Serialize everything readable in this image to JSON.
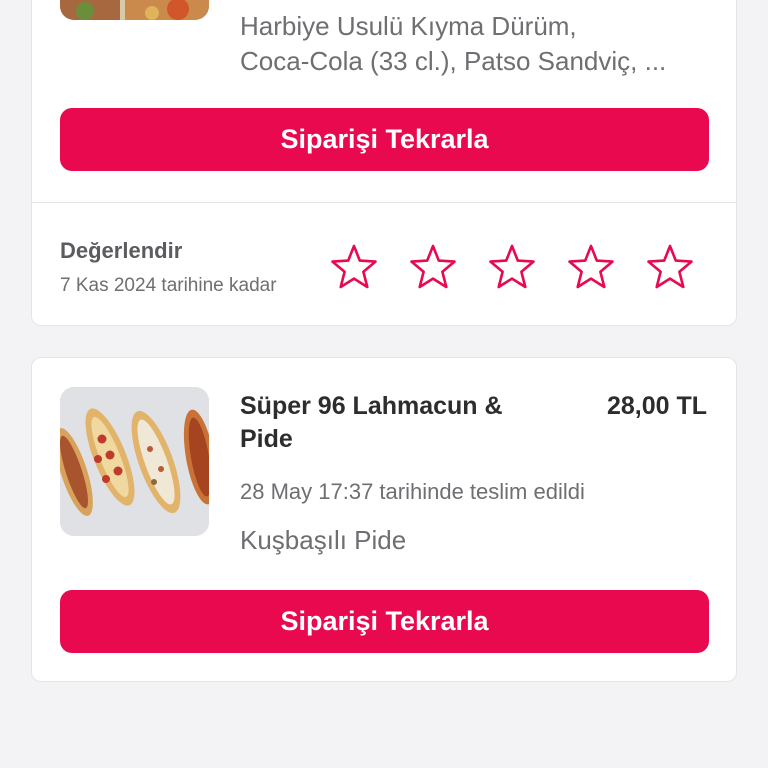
{
  "orders": [
    {
      "items": [
        "Harbiye Usulü Kıyma Dürüm,",
        "Coca-Cola (33 cl.), Patso Sandviç, ..."
      ],
      "repeat_label": "Siparişi Tekrarla",
      "rating": {
        "title": "Değerlendir",
        "deadline": "7 Kas 2024 tarihine kadar",
        "stars_filled": 0,
        "stars_total": 5
      }
    },
    {
      "restaurant": "Süper 96 Lahmacun & Pide",
      "price": "28,00 TL",
      "delivered": "28 May 17:37 tarihinde teslim edildi",
      "items": [
        "Kuşbaşılı Pide"
      ],
      "repeat_label": "Siparişi Tekrarla"
    }
  ],
  "colors": {
    "accent": "#e8094f",
    "background": "#f3f3f5",
    "card": "#ffffff",
    "muted_text": "#6e6e73"
  },
  "icons": [
    "star-outline-icon"
  ]
}
